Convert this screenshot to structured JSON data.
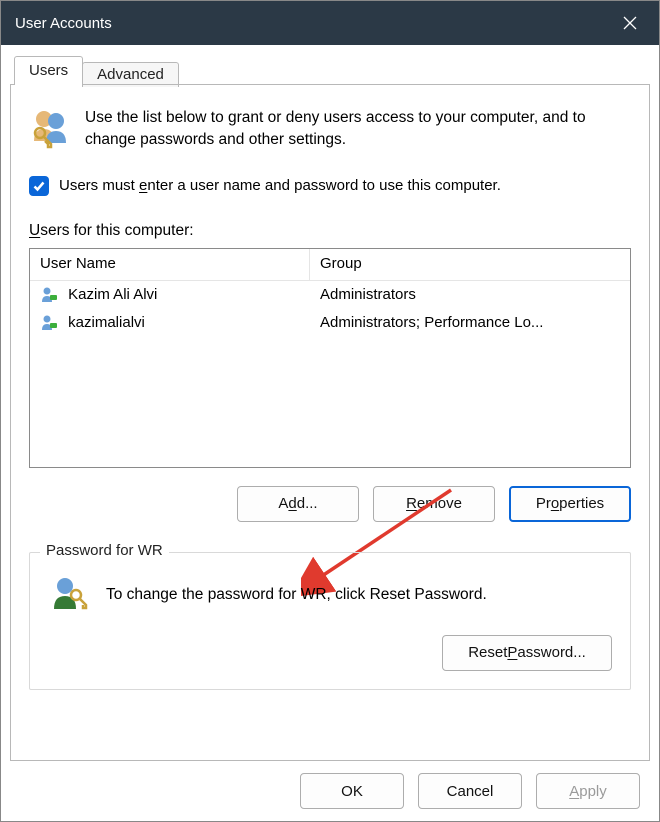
{
  "window": {
    "title": "User Accounts"
  },
  "tabs": {
    "users": "Users",
    "advanced": "Advanced"
  },
  "intro": "Use the list below to grant or deny users access to your computer, and to change passwords and other settings.",
  "checkbox": {
    "prefix": "Users must ",
    "u": "e",
    "rest": "nter a user name and password to use this computer.",
    "checked": true
  },
  "users_label": {
    "u": "U",
    "rest": "sers for this computer:"
  },
  "columns": {
    "user": "User Name",
    "group": "Group"
  },
  "users": [
    {
      "name": "Kazim Ali Alvi",
      "group": "Administrators"
    },
    {
      "name": "kazimalialvi",
      "group": "Administrators; Performance Lo..."
    }
  ],
  "buttons": {
    "add_pre": "A",
    "add_u": "d",
    "add_post": "d...",
    "remove_u": "R",
    "remove_rest": "emove",
    "properties_pre": "Pr",
    "properties_u": "o",
    "properties_post": "perties",
    "reset_pre": "Reset ",
    "reset_u": "P",
    "reset_post": "assword...",
    "ok": "OK",
    "cancel": "Cancel",
    "apply_u": "A",
    "apply_rest": "pply"
  },
  "password_group": {
    "legend": "Password for WR",
    "text": "To change the password for WR, click Reset Password."
  }
}
